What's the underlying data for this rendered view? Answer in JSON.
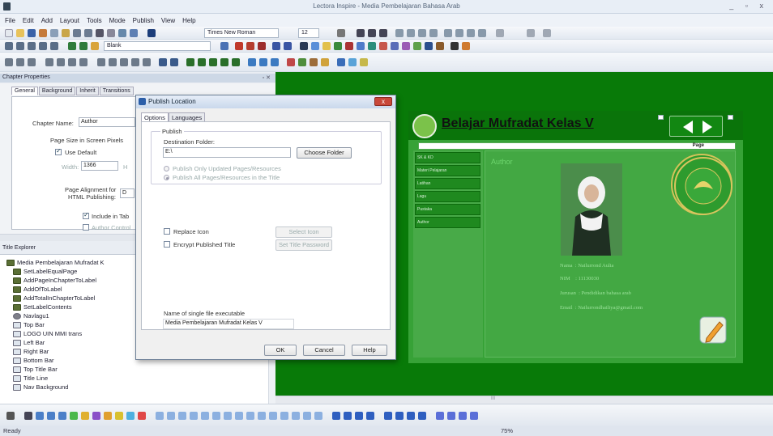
{
  "app": {
    "title": "Lectora Inspire - Media Pembelajaran Bahasa Arab",
    "window_controls": "_ ▫ x"
  },
  "menu": [
    "File",
    "Edit",
    "Add",
    "Layout",
    "Tools",
    "Mode",
    "Publish",
    "View",
    "Help"
  ],
  "toolbar": {
    "font": "Times New Roman",
    "font_size": "12",
    "style": "Blank"
  },
  "panels": {
    "chapter_properties": "Chapter Properties",
    "title_explorer": "Title Explorer",
    "close": "▫ ✕"
  },
  "chapter": {
    "tabs": [
      "General",
      "Background",
      "Inherit",
      "Transitions"
    ],
    "name_label": "Chapter Name:",
    "name_value": "Author",
    "page_size_label": "Page Size in Screen Pixels",
    "use_default": "Use Default",
    "width_label": "Width:",
    "width_value": "1366",
    "height_label": "H",
    "alignment_label_1": "Page Alignment for",
    "alignment_label_2": "HTML Publishing:",
    "alignment_value": "D",
    "include_tab": "Include in Tab",
    "author_control": "Author Control"
  },
  "explorer": {
    "items": [
      {
        "label": "Media Pembelajaran Mufradat K",
        "icon": "book"
      },
      {
        "label": "SetLabelEqualPage",
        "icon": "action"
      },
      {
        "label": "AddPageInChapterToLabel",
        "icon": "action"
      },
      {
        "label": "AddOfToLabel",
        "icon": "action"
      },
      {
        "label": "AddTotalInChapterToLabel",
        "icon": "action"
      },
      {
        "label": "SetLabelContents",
        "icon": "action"
      },
      {
        "label": "Navlagu1",
        "icon": "audio"
      },
      {
        "label": "Top Bar",
        "icon": "image"
      },
      {
        "label": "LOGO UIN MMI trans",
        "icon": "image"
      },
      {
        "label": "Left Bar",
        "icon": "image"
      },
      {
        "label": "Right Bar",
        "icon": "image"
      },
      {
        "label": "Bottom Bar",
        "icon": "image"
      },
      {
        "label": "Top Title Bar",
        "icon": "image"
      },
      {
        "label": "Title Line",
        "icon": "image"
      },
      {
        "label": "Nav Background",
        "icon": "image"
      }
    ]
  },
  "dialog": {
    "title": "Publish Location",
    "close": "x",
    "tabs": [
      "Options",
      "Languages"
    ],
    "group": "Publish",
    "dest_label": "Destination Folder:",
    "dest_value": "E:\\",
    "choose_folder": "Choose Folder",
    "radio_updated": "Publish Only Updated Pages/Resources",
    "radio_all": "Publish All Pages/Resources in the Title",
    "replace_icon": "Replace Icon",
    "select_icon": "Select Icon",
    "encrypt": "Encrypt Published Title",
    "set_password": "Set Title Password",
    "exe_label": "Name of single file executable",
    "exe_value": "Media Pembelajaran Mufradat Kelas V",
    "ok": "OK",
    "cancel": "Cancel",
    "help": "Help"
  },
  "preview": {
    "title": "Belajar Mufradat Kelas V",
    "page_label": "Page",
    "heading": "Author",
    "menu": [
      "SK & KD",
      "Materi Pelajaran",
      "Latihan",
      "Lagu",
      "Pustaka",
      "Author"
    ],
    "info": [
      {
        "k": "Nama",
        "v": ": Nailurrond Aulia"
      },
      {
        "k": "NIM",
        "v": ": 11130030"
      },
      {
        "k": "Jurusan",
        "v": ": Pendidikan bahasa arab"
      },
      {
        "k": "Email",
        "v": ": Nailurrondhailiya@gmail.com"
      }
    ],
    "seal_text_top": "UNIVERSITAS ISLAM NEGERI",
    "seal_text_bottom": "MALANG"
  },
  "status": {
    "left": "Ready",
    "zoom": "75%"
  },
  "hscroll_label": "III",
  "colors": {
    "canvas": "#087a08",
    "page": "#37a237",
    "accent": "#2b5ea8"
  }
}
